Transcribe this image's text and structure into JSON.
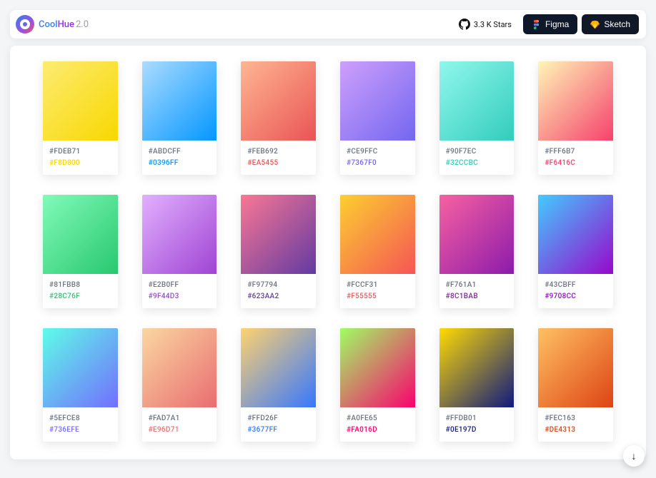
{
  "brand": {
    "a": "Cool",
    "b": "Hue",
    "version": "2.0"
  },
  "header": {
    "stars_text": "3.3 K Stars",
    "figma_label": "Figma",
    "sketch_label": "Sketch"
  },
  "fab_glyph": "↓",
  "cards": [
    {
      "from": "#FDEB71",
      "to": "#F8D800"
    },
    {
      "from": "#ABDCFF",
      "to": "#0396FF"
    },
    {
      "from": "#FEB692",
      "to": "#EA5455"
    },
    {
      "from": "#CE9FFC",
      "to": "#7367F0"
    },
    {
      "from": "#90F7EC",
      "to": "#32CCBC"
    },
    {
      "from": "#FFF6B7",
      "to": "#F6416C"
    },
    {
      "from": "#81FBB8",
      "to": "#28C76F"
    },
    {
      "from": "#E2B0FF",
      "to": "#9F44D3"
    },
    {
      "from": "#F97794",
      "to": "#623AA2"
    },
    {
      "from": "#FCCF31",
      "to": "#F55555"
    },
    {
      "from": "#F761A1",
      "to": "#8C1BAB"
    },
    {
      "from": "#43CBFF",
      "to": "#9708CC"
    },
    {
      "from": "#5EFCE8",
      "to": "#736EFE"
    },
    {
      "from": "#FAD7A1",
      "to": "#E96D71"
    },
    {
      "from": "#FFD26F",
      "to": "#3677FF"
    },
    {
      "from": "#A0FE65",
      "to": "#FA016D"
    },
    {
      "from": "#FFDB01",
      "to": "#0E197D"
    },
    {
      "from": "#FEC163",
      "to": "#DE4313"
    }
  ]
}
